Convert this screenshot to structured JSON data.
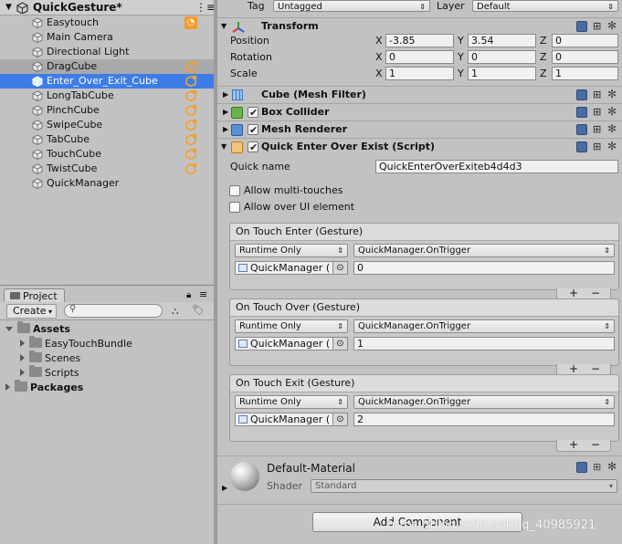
{
  "hierarchy": {
    "scene_name": "QuickGesture*",
    "items": [
      {
        "label": "Easytouch",
        "icon": "cube-icon",
        "badge": "rss-icon"
      },
      {
        "label": "Main Camera",
        "icon": "cube-icon"
      },
      {
        "label": "Directional Light",
        "icon": "cube-icon"
      },
      {
        "label": "DragCube",
        "icon": "cube-icon",
        "badge": "script-cube-icon"
      },
      {
        "label": "Enter_Over_Exit_Cube",
        "icon": "cube-icon",
        "badge": "script-cube-icon",
        "selected": true
      },
      {
        "label": "LongTabCube",
        "icon": "cube-icon",
        "badge": "script-cube-icon"
      },
      {
        "label": "PinchCube",
        "icon": "cube-icon",
        "badge": "script-cube-icon"
      },
      {
        "label": "SwipeCube",
        "icon": "cube-icon",
        "badge": "script-cube-icon"
      },
      {
        "label": "TabCube",
        "icon": "cube-icon",
        "badge": "script-cube-icon"
      },
      {
        "label": "TouchCube",
        "icon": "cube-icon",
        "badge": "script-cube-icon"
      },
      {
        "label": "TwistCube",
        "icon": "cube-icon",
        "badge": "script-cube-icon"
      },
      {
        "label": "QuickManager",
        "icon": "cube-icon"
      }
    ]
  },
  "project": {
    "tab_label": "Project",
    "create_label": "Create",
    "tree": [
      {
        "label": "Assets",
        "bold": true,
        "expanded": true
      },
      {
        "label": "EasyTouchBundle",
        "bold": false
      },
      {
        "label": "Scenes",
        "bold": false
      },
      {
        "label": "Scripts",
        "bold": false
      },
      {
        "label": "Packages",
        "bold": true,
        "expanded": false
      }
    ]
  },
  "inspector": {
    "tag_label": "Tag",
    "tag_value": "Untagged",
    "layer_label": "Layer",
    "layer_value": "Default",
    "transform": {
      "title": "Transform",
      "position_label": "Position",
      "rotation_label": "Rotation",
      "scale_label": "Scale",
      "axis_x": "X",
      "axis_y": "Y",
      "axis_z": "Z",
      "position": [
        "-3.85",
        "3.54",
        "0"
      ],
      "rotation": [
        "0",
        "0",
        "0"
      ],
      "scale": [
        "1",
        "1",
        "1"
      ]
    },
    "mesh_filter_title": "Cube (Mesh Filter)",
    "box_collider_title": "Box Collider",
    "mesh_renderer_title": "Mesh Renderer",
    "script_title": "Quick Enter Over Exist (Script)",
    "quick_name_label": "Quick name",
    "quick_name_value": "QuickEnterOverExiteb4d4d3",
    "allow_multi_label": "Allow multi-touches",
    "allow_ui_label": "Allow over UI element",
    "events": [
      {
        "title": "On Touch Enter (Gesture)",
        "runtime": "Runtime Only",
        "function": "QuickManager.OnTrigger",
        "object": "QuickManager (",
        "arg": "0"
      },
      {
        "title": "On Touch Over (Gesture)",
        "runtime": "Runtime Only",
        "function": "QuickManager.OnTrigger",
        "object": "QuickManager (",
        "arg": "1"
      },
      {
        "title": "On Touch Exit (Gesture)",
        "runtime": "Runtime Only",
        "function": "QuickManager.OnTrigger",
        "object": "QuickManager (",
        "arg": "2"
      }
    ],
    "plus": "+",
    "minus": "−",
    "material_name": "Default-Material",
    "shader_label": "Shader",
    "shader_value": "Standard",
    "add_component_label": "Add Component",
    "watermark": "https://blog.csdn.net/qq_40985921"
  },
  "colors": {
    "selection": "#3e7de7",
    "panel": "#c2c2c2",
    "script_badge": "#f0a030"
  }
}
